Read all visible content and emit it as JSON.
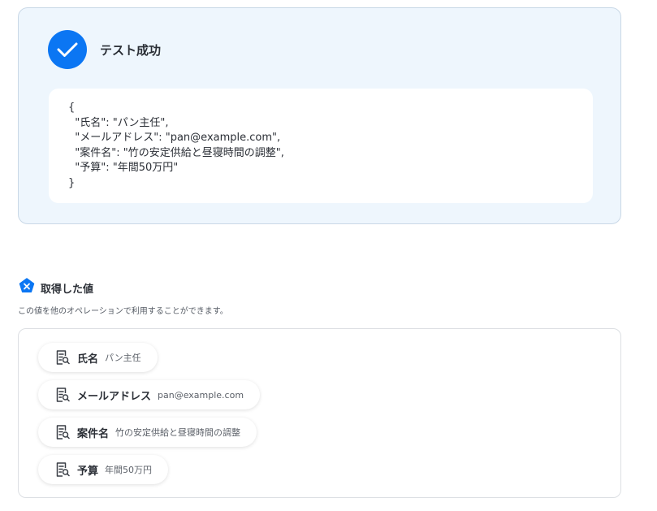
{
  "test_result": {
    "title": "テスト成功",
    "json_lines": [
      "{",
      "  \"氏名\": \"パン主任\",",
      "  \"メールアドレス\": \"pan@example.com\",",
      "  \"案件名\": \"竹の安定供給と昼寝時間の調整\",",
      "  \"予算\": \"年間50万円\"",
      "}"
    ]
  },
  "retrieved_values": {
    "title": "取得した値",
    "description": "この値を他のオペレーションで利用することができます。",
    "items": [
      {
        "label": "氏名",
        "value": "パン主任"
      },
      {
        "label": "メールアドレス",
        "value": "pan@example.com"
      },
      {
        "label": "案件名",
        "value": "竹の安定供給と昼寝時間の調整"
      },
      {
        "label": "予算",
        "value": "年間50万円"
      }
    ]
  },
  "icons": {
    "success": "check-icon",
    "section": "variable-icon",
    "item": "document-search-icon"
  },
  "colors": {
    "accent": "#0b76f3",
    "panel_background": "#eef6fd"
  }
}
